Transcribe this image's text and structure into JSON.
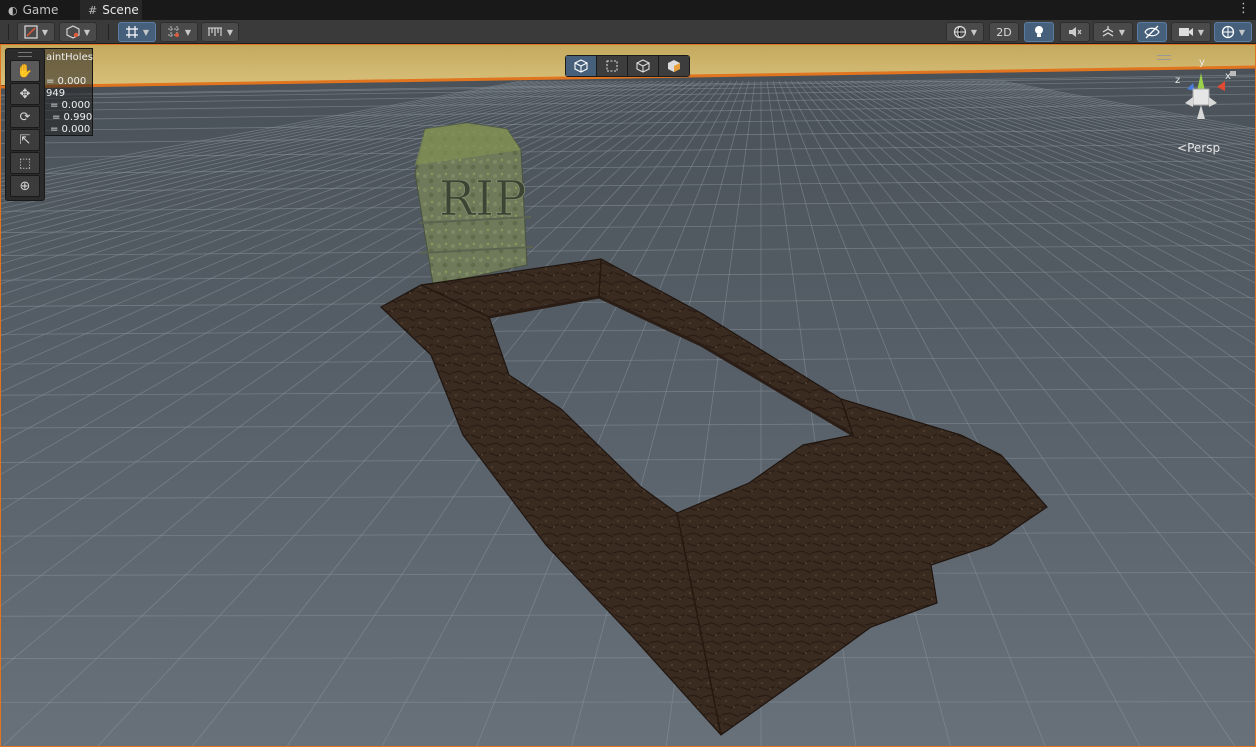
{
  "tabs": [
    {
      "label": "Game",
      "icon": "gamepad-icon"
    },
    {
      "label": "Scene",
      "icon": "grid-icon"
    }
  ],
  "toolbar": {
    "left_tools": [
      "draw-mode-icon",
      "shading-icon",
      "grid-snap-icon",
      "increment-snap-icon",
      "ruler-icon"
    ],
    "right_tools": [
      "scene-visibility-icon",
      "2D",
      "lighting-icon",
      "audio-mute-icon",
      "effects-icon",
      "hidden-objects-icon",
      "camera-icon",
      "gizmos-icon"
    ],
    "mode_2d_label": "2D"
  },
  "tool_palette": {
    "tools": [
      "hand-icon",
      "move-icon",
      "rotate-icon",
      "scale-icon",
      "rect-icon",
      "transform-icon"
    ],
    "selected": "hand-icon"
  },
  "info_panel": {
    "title": "aintHoles",
    "lines": [
      "= 0.000",
      "949",
      "= 0.000",
      "= 0.990",
      "= 0.000"
    ]
  },
  "view_modes": [
    "cube-icon",
    "rect-select-icon",
    "box-icon",
    "lit-box-icon"
  ],
  "view_modes_active": 0,
  "tombstone_text": "RIP",
  "gizmo": {
    "axes": [
      "y",
      "x",
      "z"
    ]
  },
  "projection_label": "Persp",
  "colors": {
    "selection_outline": "#e0741f",
    "grid_dark": "#3c4650",
    "grid_light": "#7e8790",
    "sky": "#c9b06a",
    "axis_x": "#e04a33",
    "axis_y": "#9bd04a",
    "axis_z": "#4a7bd6",
    "dirt": "#3b2c22"
  }
}
